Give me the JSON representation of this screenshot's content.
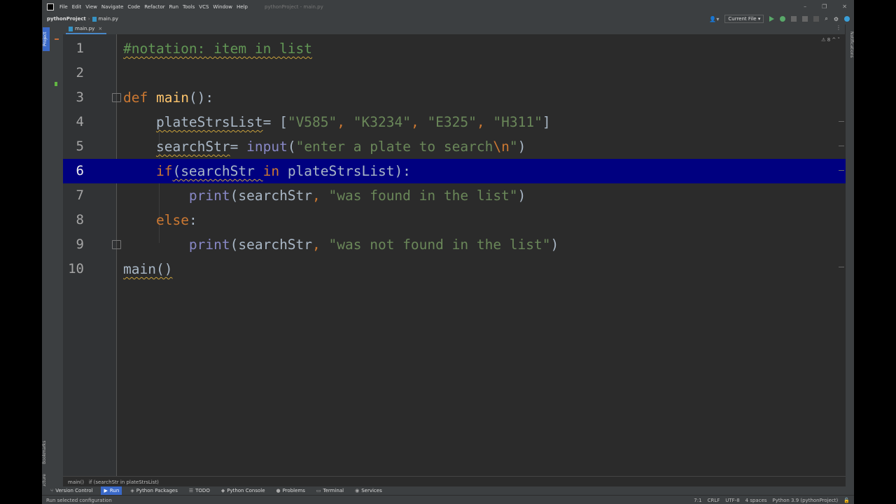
{
  "window": {
    "title": "pythonProject - main.py",
    "minimize": "–",
    "maximize": "❐",
    "close": "✕"
  },
  "menu": [
    "File",
    "Edit",
    "View",
    "Navigate",
    "Code",
    "Refactor",
    "Run",
    "Tools",
    "VCS",
    "Window",
    "Help"
  ],
  "nav": {
    "project": "pythonProject",
    "file": "main.py",
    "run_config": "Current File ▾"
  },
  "tab": {
    "label": "main.py",
    "close": "×"
  },
  "side_tabs": {
    "project": "Project",
    "bookmarks": "Bookmarks",
    "structure": "Structure",
    "notifications": "Notifications"
  },
  "editor": {
    "inspections": "⚠ 8  ^  ˅",
    "current_line": 6,
    "lines": [
      {
        "n": "1"
      },
      {
        "n": "2"
      },
      {
        "n": "3"
      },
      {
        "n": "4"
      },
      {
        "n": "5"
      },
      {
        "n": "6"
      },
      {
        "n": "7"
      },
      {
        "n": "8"
      },
      {
        "n": "9"
      },
      {
        "n": "10"
      }
    ],
    "code": {
      "l1": "#notation: item in list",
      "l3_def": "def",
      "l3_rest": " main",
      "l3_paren": "():",
      "l4_name": "plateStrsList",
      "l4_eq": "= [",
      "l4_s1": "\"V585\"",
      "l4_s2": "\"K3234\"",
      "l4_s3": "\"E325\"",
      "l4_s4": "\"H311\"",
      "l4_end": "]",
      "l5_name": "searchStr",
      "l5_eq": "= ",
      "l5_fn": "input",
      "l5_open": "(",
      "l5_str": "\"enter a plate to search",
      "l5_esc": "\\n",
      "l5_strend": "\"",
      "l5_close": ")",
      "l6_if": "if",
      "l6_rest": "(searchStr ",
      "l6_in": "in",
      "l6_rest2": " plateStrsList):",
      "l7_fn": "print",
      "l7_open": "(searchStr",
      "l7_comma": ", ",
      "l7_str": "\"was found in the list\"",
      "l7_close": ")",
      "l8_else": "else",
      "l8_colon": ":",
      "l9_fn": "print",
      "l9_open": "(searchStr",
      "l9_comma": ", ",
      "l9_str": "\"was not found in the list\"",
      "l9_close": ")",
      "l10": "main()"
    }
  },
  "editor_breadcrumbs": [
    "main()",
    "if (searchStr in plateStrsList)"
  ],
  "tool_windows": [
    {
      "label": "Version Control",
      "icon": "⑂"
    },
    {
      "label": "Run",
      "icon": "▶"
    },
    {
      "label": "Python Packages",
      "icon": "◈"
    },
    {
      "label": "TODO",
      "icon": "☰"
    },
    {
      "label": "Python Console",
      "icon": "◆"
    },
    {
      "label": "Problems",
      "icon": "●"
    },
    {
      "label": "Terminal",
      "icon": "▭"
    },
    {
      "label": "Services",
      "icon": "◉"
    }
  ],
  "status": {
    "message": "Run selected configuration",
    "position": "7:1",
    "line_sep": "CRLF",
    "encoding": "UTF-8",
    "indent": "4 spaces",
    "interpreter": "Python 3.9 (pythonProject)"
  }
}
